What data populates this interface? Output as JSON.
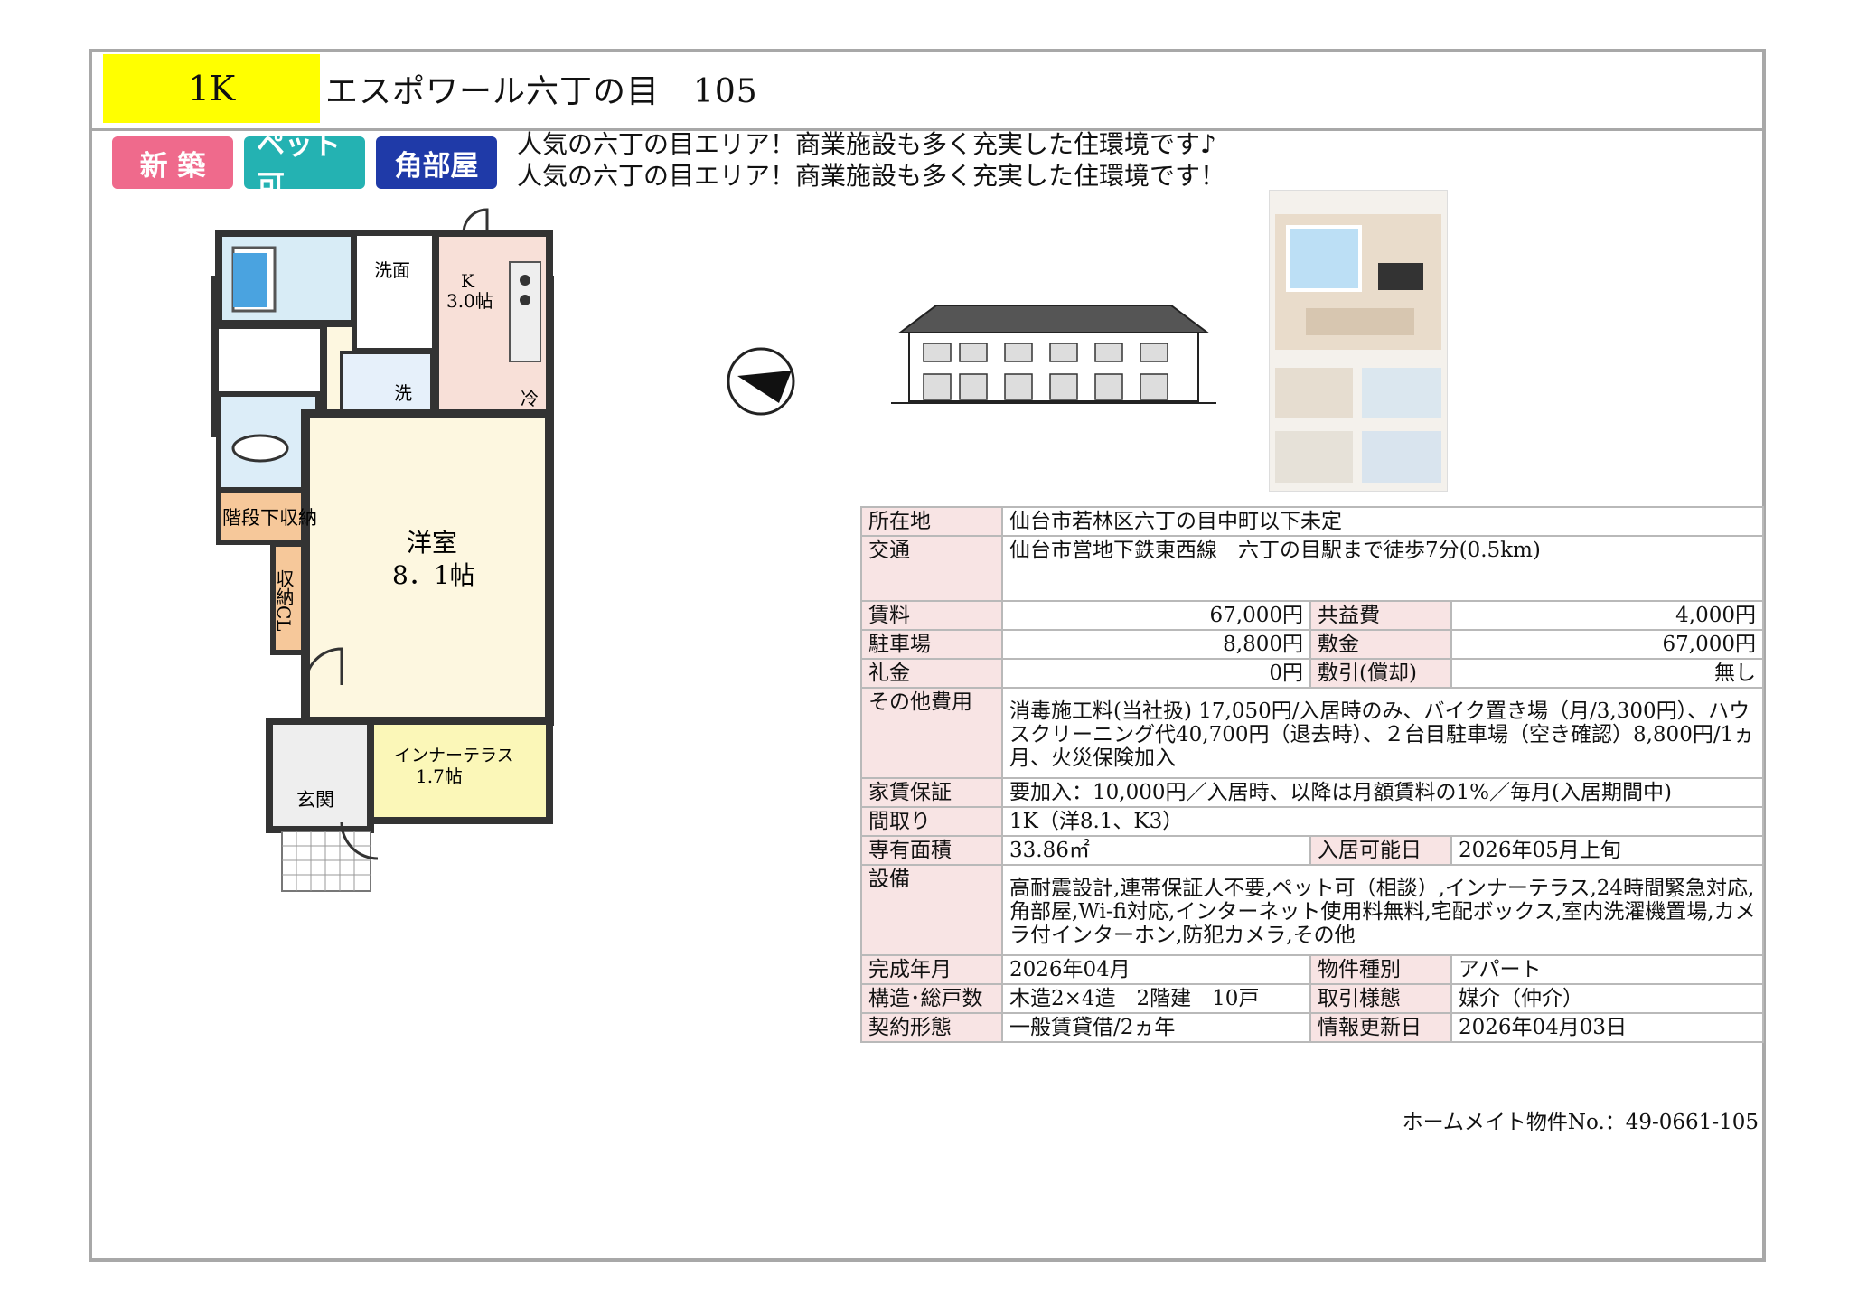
{
  "header": {
    "layout": "1K",
    "title": "エスポワール六丁の目　105"
  },
  "tags": [
    "新 築",
    "ペット可",
    "角部屋"
  ],
  "catch_copy": [
    "人気の六丁の目エリア！商業施設も多く充実した住環境です♪",
    "人気の六丁の目エリア！商業施設も多く充実した住環境です！"
  ],
  "floor_plan": {
    "washroom": "洗面",
    "kitchen": "K",
    "kitchen_size": "3.0帖",
    "wash": "洗",
    "fridge": "冷",
    "stair_storage": "階段下収納",
    "closet": "収納CL",
    "western": "洋室",
    "western_size": "8．1帖",
    "terrace": "インナーテラス",
    "terrace_size": "1.7帖",
    "entrance": "玄関"
  },
  "info": {
    "location_label": "所在地",
    "location": "仙台市若林区六丁の目中町以下未定",
    "transit_label": "交通",
    "transit": "仙台市営地下鉄東西線　六丁の目駅まで徒歩7分(0.5km)",
    "rent_label": "賃料",
    "rent": "67,000円",
    "common_fee_label": "共益費",
    "common_fee": "4,000円",
    "parking_label": "駐車場",
    "parking": "8,800円",
    "deposit_label": "敷金",
    "deposit": "67,000円",
    "key_money_label": "礼金",
    "key_money": "0円",
    "amortization_label": "敷引(償却)",
    "amortization": "無し",
    "other_fees_label": "その他費用",
    "other_fees": "消毒施工料(当社扱) 17,050円/入居時のみ、バイク置き場（月/3,300円）、ハウスクリーニング代40,700円（退去時）、２台目駐車場（空き確認）8,800円/1ヵ月、火災保険加入",
    "guarantee_label": "家賃保証",
    "guarantee": "要加入：10,000円／入居時、以降は月額賃料の1%／毎月(入居期間中)",
    "layout_label": "間取り",
    "layout": "1K（洋8.1、K3）",
    "area_label": "専有面積",
    "area": "33.86㎡",
    "move_in_label": "入居可能日",
    "move_in": "2026年05月上旬",
    "facilities_label": "設備",
    "facilities": "高耐震設計,連帯保証人不要,ペット可（相談）,インナーテラス,24時間緊急対応,角部屋,Wi-fi対応,インターネット使用料無料,宅配ボックス,室内洗濯機置場,カメラ付インターホン,防犯カメラ,その他",
    "completed_label": "完成年月",
    "completed": "2026年04月",
    "type_label": "物件種別",
    "type": "アパート",
    "structure_label": "構造･総戸数",
    "structure": "木造2×4造　2階建　10戸",
    "deal_label": "取引様態",
    "deal": "媒介（仲介）",
    "contract_label": "契約形態",
    "contract": "一般賃貸借/2ヵ年",
    "updated_label": "情報更新日",
    "updated": "2026年04月03日"
  },
  "reference": "ホームメイト物件No.：49-0661-105",
  "colors": {
    "badge": "#ffff00",
    "tag_new": "#ef6a8c",
    "tag_pet": "#24b2b2",
    "tag_corner": "#1f3aa8",
    "label_bg": "#f8e4e4"
  }
}
